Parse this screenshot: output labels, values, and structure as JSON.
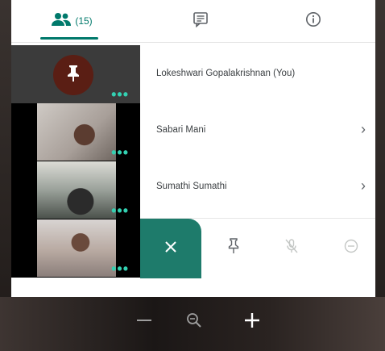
{
  "tabs": {
    "people_count": "(15)",
    "accent": "#00796b"
  },
  "participants": [
    {
      "name": "Lokeshwari Gopalakrishnan (You)",
      "has_chevron": false
    },
    {
      "name": "Sabari Mani",
      "has_chevron": true
    },
    {
      "name": "Sumathi Sumathi",
      "has_chevron": true
    }
  ],
  "tiles": {
    "more_label": "•••"
  },
  "chevron": "›",
  "colors": {
    "close_button": "#1e7b6b",
    "avatar_bg": "#5a1e14",
    "dots": "#33d1b2"
  },
  "icons": [
    "people-icon",
    "chat-icon",
    "info-icon",
    "pin-icon",
    "mute-mic-icon",
    "remove-icon",
    "close-icon",
    "zoom-out-icon",
    "zoom-icon",
    "zoom-in-icon"
  ]
}
